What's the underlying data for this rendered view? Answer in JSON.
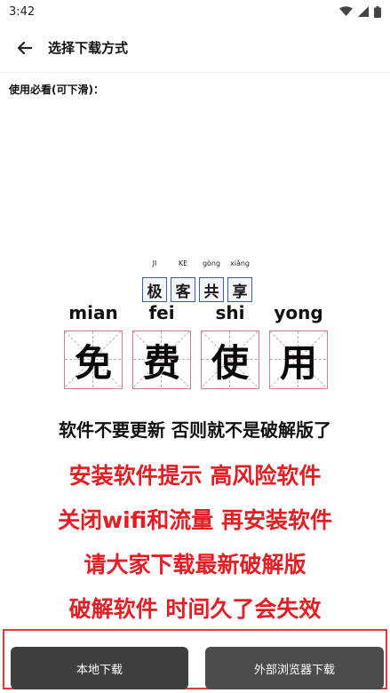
{
  "status": {
    "time": "3:42"
  },
  "header": {
    "title": "选择下载方式"
  },
  "notice": {
    "label": "使用必看(可下滑)："
  },
  "poster": {
    "brand_pinyin": [
      "JI",
      "KE",
      "gòng",
      "xiǎng"
    ],
    "brand_chars": [
      "极",
      "客",
      "共",
      "享"
    ],
    "big_pinyin": [
      "mian",
      "fei",
      "shi",
      "yong"
    ],
    "big_chars": [
      "免",
      "费",
      "使",
      "用"
    ],
    "black_line": "软件不要更新 否则就不是破解版了",
    "red_lines": [
      "安装软件提示 高风险软件",
      "关闭wifi和流量 再安装软件",
      "请大家下载最新破解版",
      "破解软件 时间久了会失效"
    ]
  },
  "actions": {
    "local_download": "本地下载",
    "external_browser_download": "外部浏览器下载"
  },
  "colors": {
    "accent_red": "#e31e24",
    "button_dark": "#3e3e3e"
  }
}
